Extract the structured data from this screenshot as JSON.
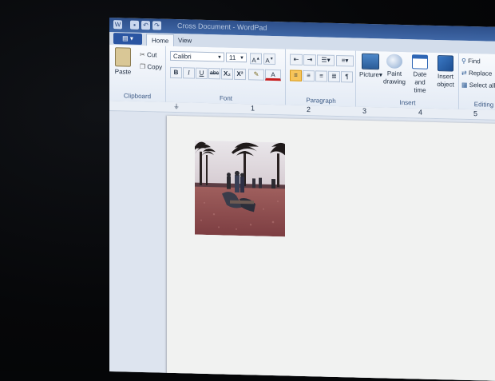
{
  "window": {
    "title": "Cross Document - WordPad"
  },
  "quick_access": [
    "save-icon",
    "undo-icon",
    "redo-icon"
  ],
  "tabs": [
    {
      "label": "Home",
      "active": true
    },
    {
      "label": "View",
      "active": false
    }
  ],
  "ribbon": {
    "clipboard": {
      "label": "Clipboard",
      "paste": "Paste",
      "cut": "Cut",
      "copy": "Copy"
    },
    "font": {
      "label": "Font",
      "family": "Calibri",
      "size": "11",
      "bold": "B",
      "italic": "I",
      "underline": "U",
      "strike": "abc",
      "subscript": "X₂",
      "superscript": "X²"
    },
    "paragraph": {
      "label": "Paragraph"
    },
    "insert": {
      "label": "Insert",
      "picture": "Picture",
      "paint_1": "Paint",
      "paint_2": "drawing",
      "date_1": "Date and",
      "date_2": "time",
      "obj_1": "Insert",
      "obj_2": "object"
    },
    "editing": {
      "label": "Editing",
      "find": "Find",
      "replace": "Replace",
      "select_all": "Select all"
    }
  },
  "ruler": {
    "numbers": [
      "1",
      "2",
      "3",
      "4",
      "5"
    ]
  },
  "colors": {
    "title_bar": "#3f67a6",
    "app_button": "#2a55a2",
    "page": "#f1f2f1"
  }
}
